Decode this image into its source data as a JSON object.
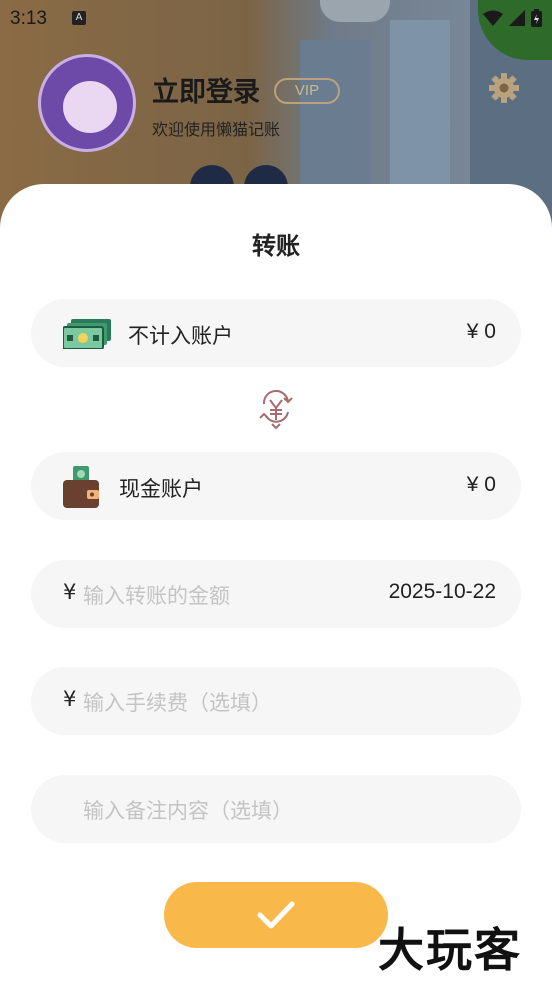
{
  "status_bar": {
    "time": "3:13",
    "notification_glyph": "A"
  },
  "profile": {
    "title": "立即登录",
    "vip": "VIP",
    "subtitle": "欢迎使用懒猫记账"
  },
  "sheet": {
    "title": "转账",
    "from_account": {
      "name": "不计入账户",
      "amount": "¥ 0",
      "icon": "cash-stack-icon"
    },
    "swap_icon": "yen-transfer-icon",
    "to_account": {
      "name": "现金账户",
      "amount": "¥ 0",
      "icon": "wallet-icon"
    },
    "amount_field": {
      "currency": "¥",
      "placeholder": "输入转账的金额",
      "date": "2025-10-22"
    },
    "fee_field": {
      "currency": "¥",
      "placeholder": "输入手续费（选填）"
    },
    "note_field": {
      "placeholder": "输入备注内容（选填）"
    },
    "confirm_icon": "check-icon"
  },
  "watermark": "大玩客",
  "colors": {
    "accent": "#f8b94a",
    "field_bg": "#f6f6f6",
    "placeholder": "#c4c4c4"
  }
}
